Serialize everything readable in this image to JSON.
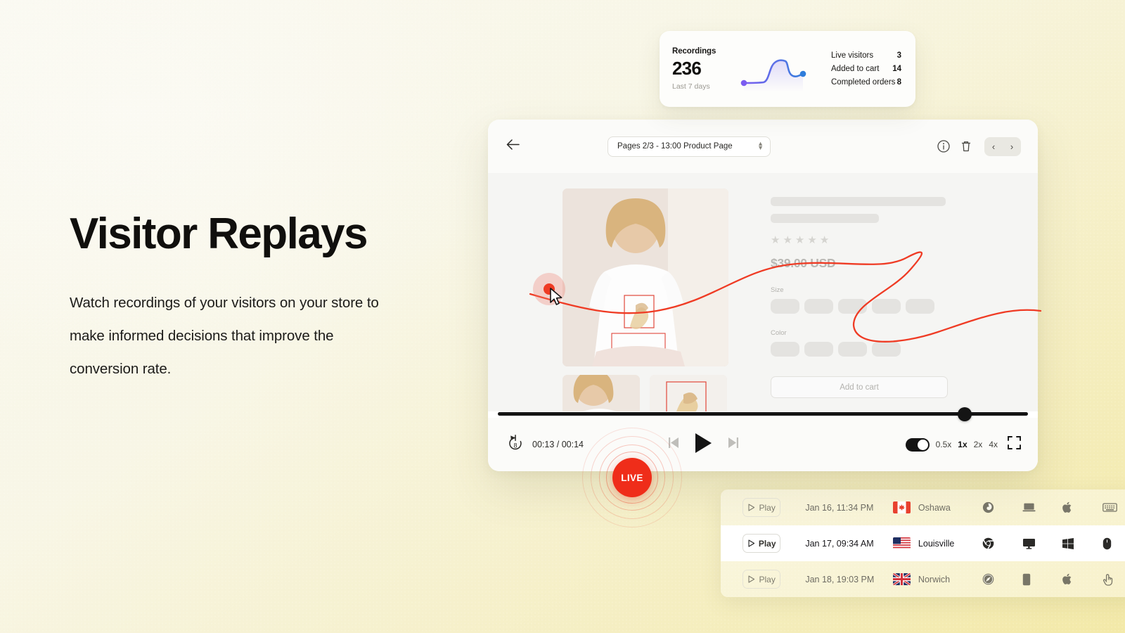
{
  "hero": {
    "title": "Visitor Replays",
    "paragraph": "Watch recordings of your visitors on your store to make informed decisions that improve the conversion rate."
  },
  "stats_card": {
    "label": "Recordings",
    "value": "236",
    "period": "Last 7 days",
    "metrics": [
      {
        "label": "Live visitors",
        "value": "3"
      },
      {
        "label": "Added to cart",
        "value": "14"
      },
      {
        "label": "Completed orders",
        "value": "8"
      }
    ],
    "sparkline_start_color": "#7b5cf0",
    "sparkline_end_color": "#2f7ddb"
  },
  "player": {
    "back_icon": "back-arrow-icon",
    "page_selector": "Pages 2/3 - 13:00 Product Page",
    "info_icon": "info-icon",
    "delete_icon": "trash-icon",
    "prev_label": "‹",
    "next_label": "›",
    "time": "00:13 / 00:14",
    "rewind_label": "8",
    "speeds": [
      {
        "label": "0.5x",
        "active": false
      },
      {
        "label": "1x",
        "active": true
      },
      {
        "label": "2x",
        "active": false
      },
      {
        "label": "4x",
        "active": false
      }
    ],
    "fullscreen_icon": "fullscreen-icon",
    "progress_percent": 88
  },
  "store_page": {
    "price": "$39.00 USD",
    "size_label": "Size",
    "color_label": "Color",
    "add_to_cart": "Add to cart",
    "star_count": 5,
    "size_swatches": 5,
    "color_swatches": 4
  },
  "live_badge": {
    "label": "LIVE",
    "color": "#ef2d1a"
  },
  "recordings": {
    "play_label": "Play",
    "rows": [
      {
        "date": "Jan 16, 11:34 PM",
        "country": "Canada",
        "city": "Oshawa",
        "browser": "firefox-icon",
        "device": "laptop-icon",
        "os": "apple-icon",
        "input": "keyboard-icon"
      },
      {
        "date": "Jan 17, 09:34 AM",
        "country": "United States",
        "city": "Louisville",
        "browser": "chrome-icon",
        "device": "desktop-icon",
        "os": "windows-icon",
        "input": "mouse-icon"
      },
      {
        "date": "Jan 18, 19:03 PM",
        "country": "United Kingdom",
        "city": "Norwich",
        "browser": "safari-icon",
        "device": "mobile-icon",
        "os": "apple-icon",
        "input": "touch-icon"
      }
    ]
  }
}
